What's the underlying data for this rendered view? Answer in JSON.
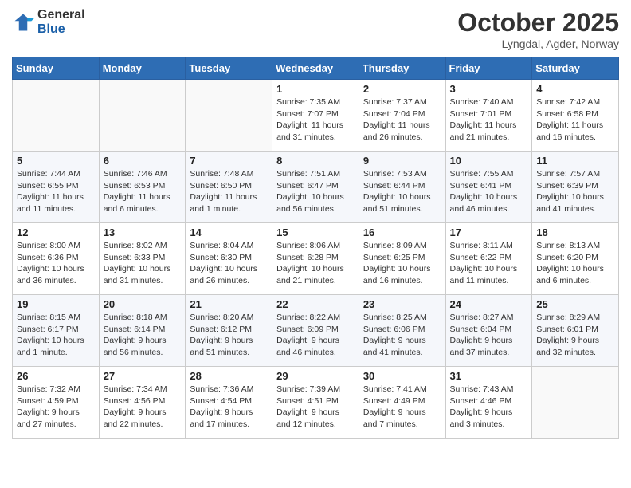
{
  "logo": {
    "general": "General",
    "blue": "Blue"
  },
  "header": {
    "month": "October 2025",
    "location": "Lyngdal, Agder, Norway"
  },
  "weekdays": [
    "Sunday",
    "Monday",
    "Tuesday",
    "Wednesday",
    "Thursday",
    "Friday",
    "Saturday"
  ],
  "weeks": [
    [
      {
        "day": "",
        "info": ""
      },
      {
        "day": "",
        "info": ""
      },
      {
        "day": "",
        "info": ""
      },
      {
        "day": "1",
        "info": "Sunrise: 7:35 AM\nSunset: 7:07 PM\nDaylight: 11 hours\nand 31 minutes."
      },
      {
        "day": "2",
        "info": "Sunrise: 7:37 AM\nSunset: 7:04 PM\nDaylight: 11 hours\nand 26 minutes."
      },
      {
        "day": "3",
        "info": "Sunrise: 7:40 AM\nSunset: 7:01 PM\nDaylight: 11 hours\nand 21 minutes."
      },
      {
        "day": "4",
        "info": "Sunrise: 7:42 AM\nSunset: 6:58 PM\nDaylight: 11 hours\nand 16 minutes."
      }
    ],
    [
      {
        "day": "5",
        "info": "Sunrise: 7:44 AM\nSunset: 6:55 PM\nDaylight: 11 hours\nand 11 minutes."
      },
      {
        "day": "6",
        "info": "Sunrise: 7:46 AM\nSunset: 6:53 PM\nDaylight: 11 hours\nand 6 minutes."
      },
      {
        "day": "7",
        "info": "Sunrise: 7:48 AM\nSunset: 6:50 PM\nDaylight: 11 hours\nand 1 minute."
      },
      {
        "day": "8",
        "info": "Sunrise: 7:51 AM\nSunset: 6:47 PM\nDaylight: 10 hours\nand 56 minutes."
      },
      {
        "day": "9",
        "info": "Sunrise: 7:53 AM\nSunset: 6:44 PM\nDaylight: 10 hours\nand 51 minutes."
      },
      {
        "day": "10",
        "info": "Sunrise: 7:55 AM\nSunset: 6:41 PM\nDaylight: 10 hours\nand 46 minutes."
      },
      {
        "day": "11",
        "info": "Sunrise: 7:57 AM\nSunset: 6:39 PM\nDaylight: 10 hours\nand 41 minutes."
      }
    ],
    [
      {
        "day": "12",
        "info": "Sunrise: 8:00 AM\nSunset: 6:36 PM\nDaylight: 10 hours\nand 36 minutes."
      },
      {
        "day": "13",
        "info": "Sunrise: 8:02 AM\nSunset: 6:33 PM\nDaylight: 10 hours\nand 31 minutes."
      },
      {
        "day": "14",
        "info": "Sunrise: 8:04 AM\nSunset: 6:30 PM\nDaylight: 10 hours\nand 26 minutes."
      },
      {
        "day": "15",
        "info": "Sunrise: 8:06 AM\nSunset: 6:28 PM\nDaylight: 10 hours\nand 21 minutes."
      },
      {
        "day": "16",
        "info": "Sunrise: 8:09 AM\nSunset: 6:25 PM\nDaylight: 10 hours\nand 16 minutes."
      },
      {
        "day": "17",
        "info": "Sunrise: 8:11 AM\nSunset: 6:22 PM\nDaylight: 10 hours\nand 11 minutes."
      },
      {
        "day": "18",
        "info": "Sunrise: 8:13 AM\nSunset: 6:20 PM\nDaylight: 10 hours\nand 6 minutes."
      }
    ],
    [
      {
        "day": "19",
        "info": "Sunrise: 8:15 AM\nSunset: 6:17 PM\nDaylight: 10 hours\nand 1 minute."
      },
      {
        "day": "20",
        "info": "Sunrise: 8:18 AM\nSunset: 6:14 PM\nDaylight: 9 hours\nand 56 minutes."
      },
      {
        "day": "21",
        "info": "Sunrise: 8:20 AM\nSunset: 6:12 PM\nDaylight: 9 hours\nand 51 minutes."
      },
      {
        "day": "22",
        "info": "Sunrise: 8:22 AM\nSunset: 6:09 PM\nDaylight: 9 hours\nand 46 minutes."
      },
      {
        "day": "23",
        "info": "Sunrise: 8:25 AM\nSunset: 6:06 PM\nDaylight: 9 hours\nand 41 minutes."
      },
      {
        "day": "24",
        "info": "Sunrise: 8:27 AM\nSunset: 6:04 PM\nDaylight: 9 hours\nand 37 minutes."
      },
      {
        "day": "25",
        "info": "Sunrise: 8:29 AM\nSunset: 6:01 PM\nDaylight: 9 hours\nand 32 minutes."
      }
    ],
    [
      {
        "day": "26",
        "info": "Sunrise: 7:32 AM\nSunset: 4:59 PM\nDaylight: 9 hours\nand 27 minutes."
      },
      {
        "day": "27",
        "info": "Sunrise: 7:34 AM\nSunset: 4:56 PM\nDaylight: 9 hours\nand 22 minutes."
      },
      {
        "day": "28",
        "info": "Sunrise: 7:36 AM\nSunset: 4:54 PM\nDaylight: 9 hours\nand 17 minutes."
      },
      {
        "day": "29",
        "info": "Sunrise: 7:39 AM\nSunset: 4:51 PM\nDaylight: 9 hours\nand 12 minutes."
      },
      {
        "day": "30",
        "info": "Sunrise: 7:41 AM\nSunset: 4:49 PM\nDaylight: 9 hours\nand 7 minutes."
      },
      {
        "day": "31",
        "info": "Sunrise: 7:43 AM\nSunset: 4:46 PM\nDaylight: 9 hours\nand 3 minutes."
      },
      {
        "day": "",
        "info": ""
      }
    ]
  ]
}
